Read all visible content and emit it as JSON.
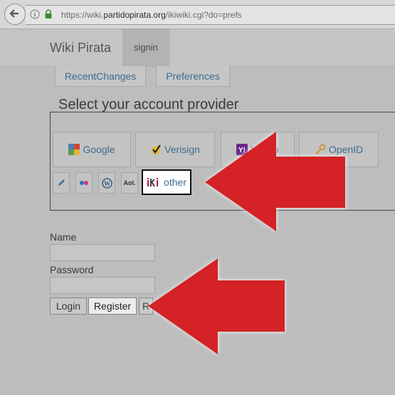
{
  "browser": {
    "url_prefix": "https://wiki.",
    "url_domain": "partidopirata.org",
    "url_suffix": "/ikiwiki.cgi?do=prefs"
  },
  "header": {
    "site_title": "Wiki Pirata",
    "signin_tab": "signin"
  },
  "tabs": [
    {
      "label": "RecentChanges"
    },
    {
      "label": "Preferences"
    }
  ],
  "provider_section": {
    "title": "Select your account provider",
    "providers": [
      {
        "label": "Google",
        "icon": "google-icon"
      },
      {
        "label": "Verisign",
        "icon": "verisign-check-icon"
      },
      {
        "label": "Yahoo",
        "icon": "yahoo-icon"
      },
      {
        "label": "OpenID",
        "icon": "openid-key-icon"
      }
    ],
    "small_providers": [
      {
        "icon": "livejournal-pencil-icon"
      },
      {
        "icon": "flickr-icon"
      },
      {
        "icon": "wordpress-icon"
      },
      {
        "label": "Aol.",
        "icon": "aol-icon"
      }
    ],
    "other": {
      "logo": "iki",
      "label": "other"
    }
  },
  "login_form": {
    "name_label": "Name",
    "password_label": "Password",
    "login_button": "Login",
    "register_button": "Register",
    "third_button": "R"
  },
  "overlay": {
    "arrow_color": "#d42226"
  }
}
